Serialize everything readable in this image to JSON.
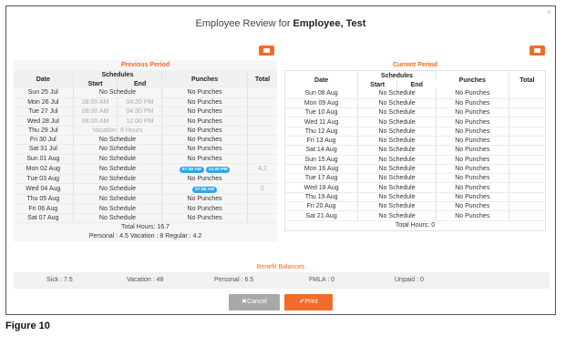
{
  "dialog": {
    "title_prefix": "Employee Review for ",
    "title_name": "Employee, Test",
    "close_glyph": "×"
  },
  "headers": {
    "date": "Date",
    "schedules": "Schedules",
    "start": "Start",
    "end": "End",
    "punches": "Punches",
    "total": "Total"
  },
  "previous": {
    "title": "Previous Period",
    "rows": [
      {
        "date": "Sun 25 Jul",
        "sched": "No Schedule",
        "punches": "No Punches",
        "total": ""
      },
      {
        "date": "Mon 26 Jul",
        "start": "08:00 AM",
        "end": "04:30 PM",
        "punches": "No Punches",
        "total": ""
      },
      {
        "date": "Tue 27 Jul",
        "start": "08:00 AM",
        "end": "04:30 PM",
        "punches": "No Punches",
        "total": ""
      },
      {
        "date": "Wed 28 Jul",
        "start": "08:00 AM",
        "end": "12:00 PM",
        "punches": "No Punches",
        "total": ""
      },
      {
        "date": "Thu 29 Jul",
        "sched": "Vacation: 8 Hours",
        "sched_muted": true,
        "punches": "No Punches",
        "total": ""
      },
      {
        "date": "Fri 30 Jul",
        "sched": "No Schedule",
        "punches": "No Punches",
        "total": ""
      },
      {
        "date": "Sat 31 Jul",
        "sched": "No Schedule",
        "punches": "No Punches",
        "total": ""
      },
      {
        "date": "Sun 01 Aug",
        "sched": "No Schedule",
        "punches": "No Punches",
        "total": ""
      },
      {
        "date": "Mon 02 Aug",
        "sched": "No Schedule",
        "pills": [
          "07:48 AM",
          "12:00 PM"
        ],
        "total": "4.2"
      },
      {
        "date": "Tue 03 Aug",
        "sched": "No Schedule",
        "punches": "No Punches",
        "total": ""
      },
      {
        "date": "Wed 04 Aug",
        "sched": "No Schedule",
        "pills": [
          "07:55 AM"
        ],
        "total": "0"
      },
      {
        "date": "Thu 05 Aug",
        "sched": "No Schedule",
        "punches": "No Punches",
        "total": ""
      },
      {
        "date": "Fri 06 Aug",
        "sched": "No Schedule",
        "punches": "No Punches",
        "total": ""
      },
      {
        "date": "Sat 07 Aug",
        "sched": "No Schedule",
        "punches": "No Punches",
        "total": ""
      }
    ],
    "total_hours": "Total Hours: 16.7",
    "breakdown": "Personal : 4.5  Vacation : 8  Regular : 4.2"
  },
  "current": {
    "title": "Current Period",
    "rows": [
      {
        "date": "Sun 08 Aug",
        "sched": "No Schedule",
        "punches": "No Punches",
        "total": ""
      },
      {
        "date": "Mon 09 Aug",
        "sched": "No Schedule",
        "punches": "No Punches",
        "total": ""
      },
      {
        "date": "Tue 10 Aug",
        "sched": "No Schedule",
        "punches": "No Punches",
        "total": ""
      },
      {
        "date": "Wed 11 Aug",
        "sched": "No Schedule",
        "punches": "No Punches",
        "total": ""
      },
      {
        "date": "Thu 12 Aug",
        "sched": "No Schedule",
        "punches": "No Punches",
        "total": ""
      },
      {
        "date": "Fri 13 Aug",
        "sched": "No Schedule",
        "punches": "No Punches",
        "total": ""
      },
      {
        "date": "Sat 14 Aug",
        "sched": "No Schedule",
        "punches": "No Punches",
        "total": ""
      },
      {
        "date": "Sun 15 Aug",
        "sched": "No Schedule",
        "punches": "No Punches",
        "total": ""
      },
      {
        "date": "Mon 16 Aug",
        "sched": "No Schedule",
        "punches": "No Punches",
        "total": ""
      },
      {
        "date": "Tue 17 Aug",
        "sched": "No Schedule",
        "punches": "No Punches",
        "total": ""
      },
      {
        "date": "Wed 18 Aug",
        "sched": "No Schedule",
        "punches": "No Punches",
        "total": ""
      },
      {
        "date": "Thu 19 Aug",
        "sched": "No Schedule",
        "punches": "No Punches",
        "total": ""
      },
      {
        "date": "Fri 20 Aug",
        "sched": "No Schedule",
        "punches": "No Punches",
        "total": ""
      },
      {
        "date": "Sat 21 Aug",
        "sched": "No Schedule",
        "punches": "No Punches",
        "total": ""
      }
    ],
    "total_hours": "Total Hours: 0"
  },
  "benefits": {
    "title": "Benefit Balances",
    "sick": "Sick : 7.5",
    "vacation": "Vacation : 48",
    "personal": "Personal : 6.5",
    "fmla": "FMLA : 0",
    "unpaid": "Unpaid : 0"
  },
  "buttons": {
    "cancel": "✖Cancel",
    "print": "✔Print"
  },
  "caption": "Figure 10",
  "colors": {
    "accent": "#f26b2a",
    "pill": "#2ea7e8",
    "cancel": "#a8a8a8"
  }
}
